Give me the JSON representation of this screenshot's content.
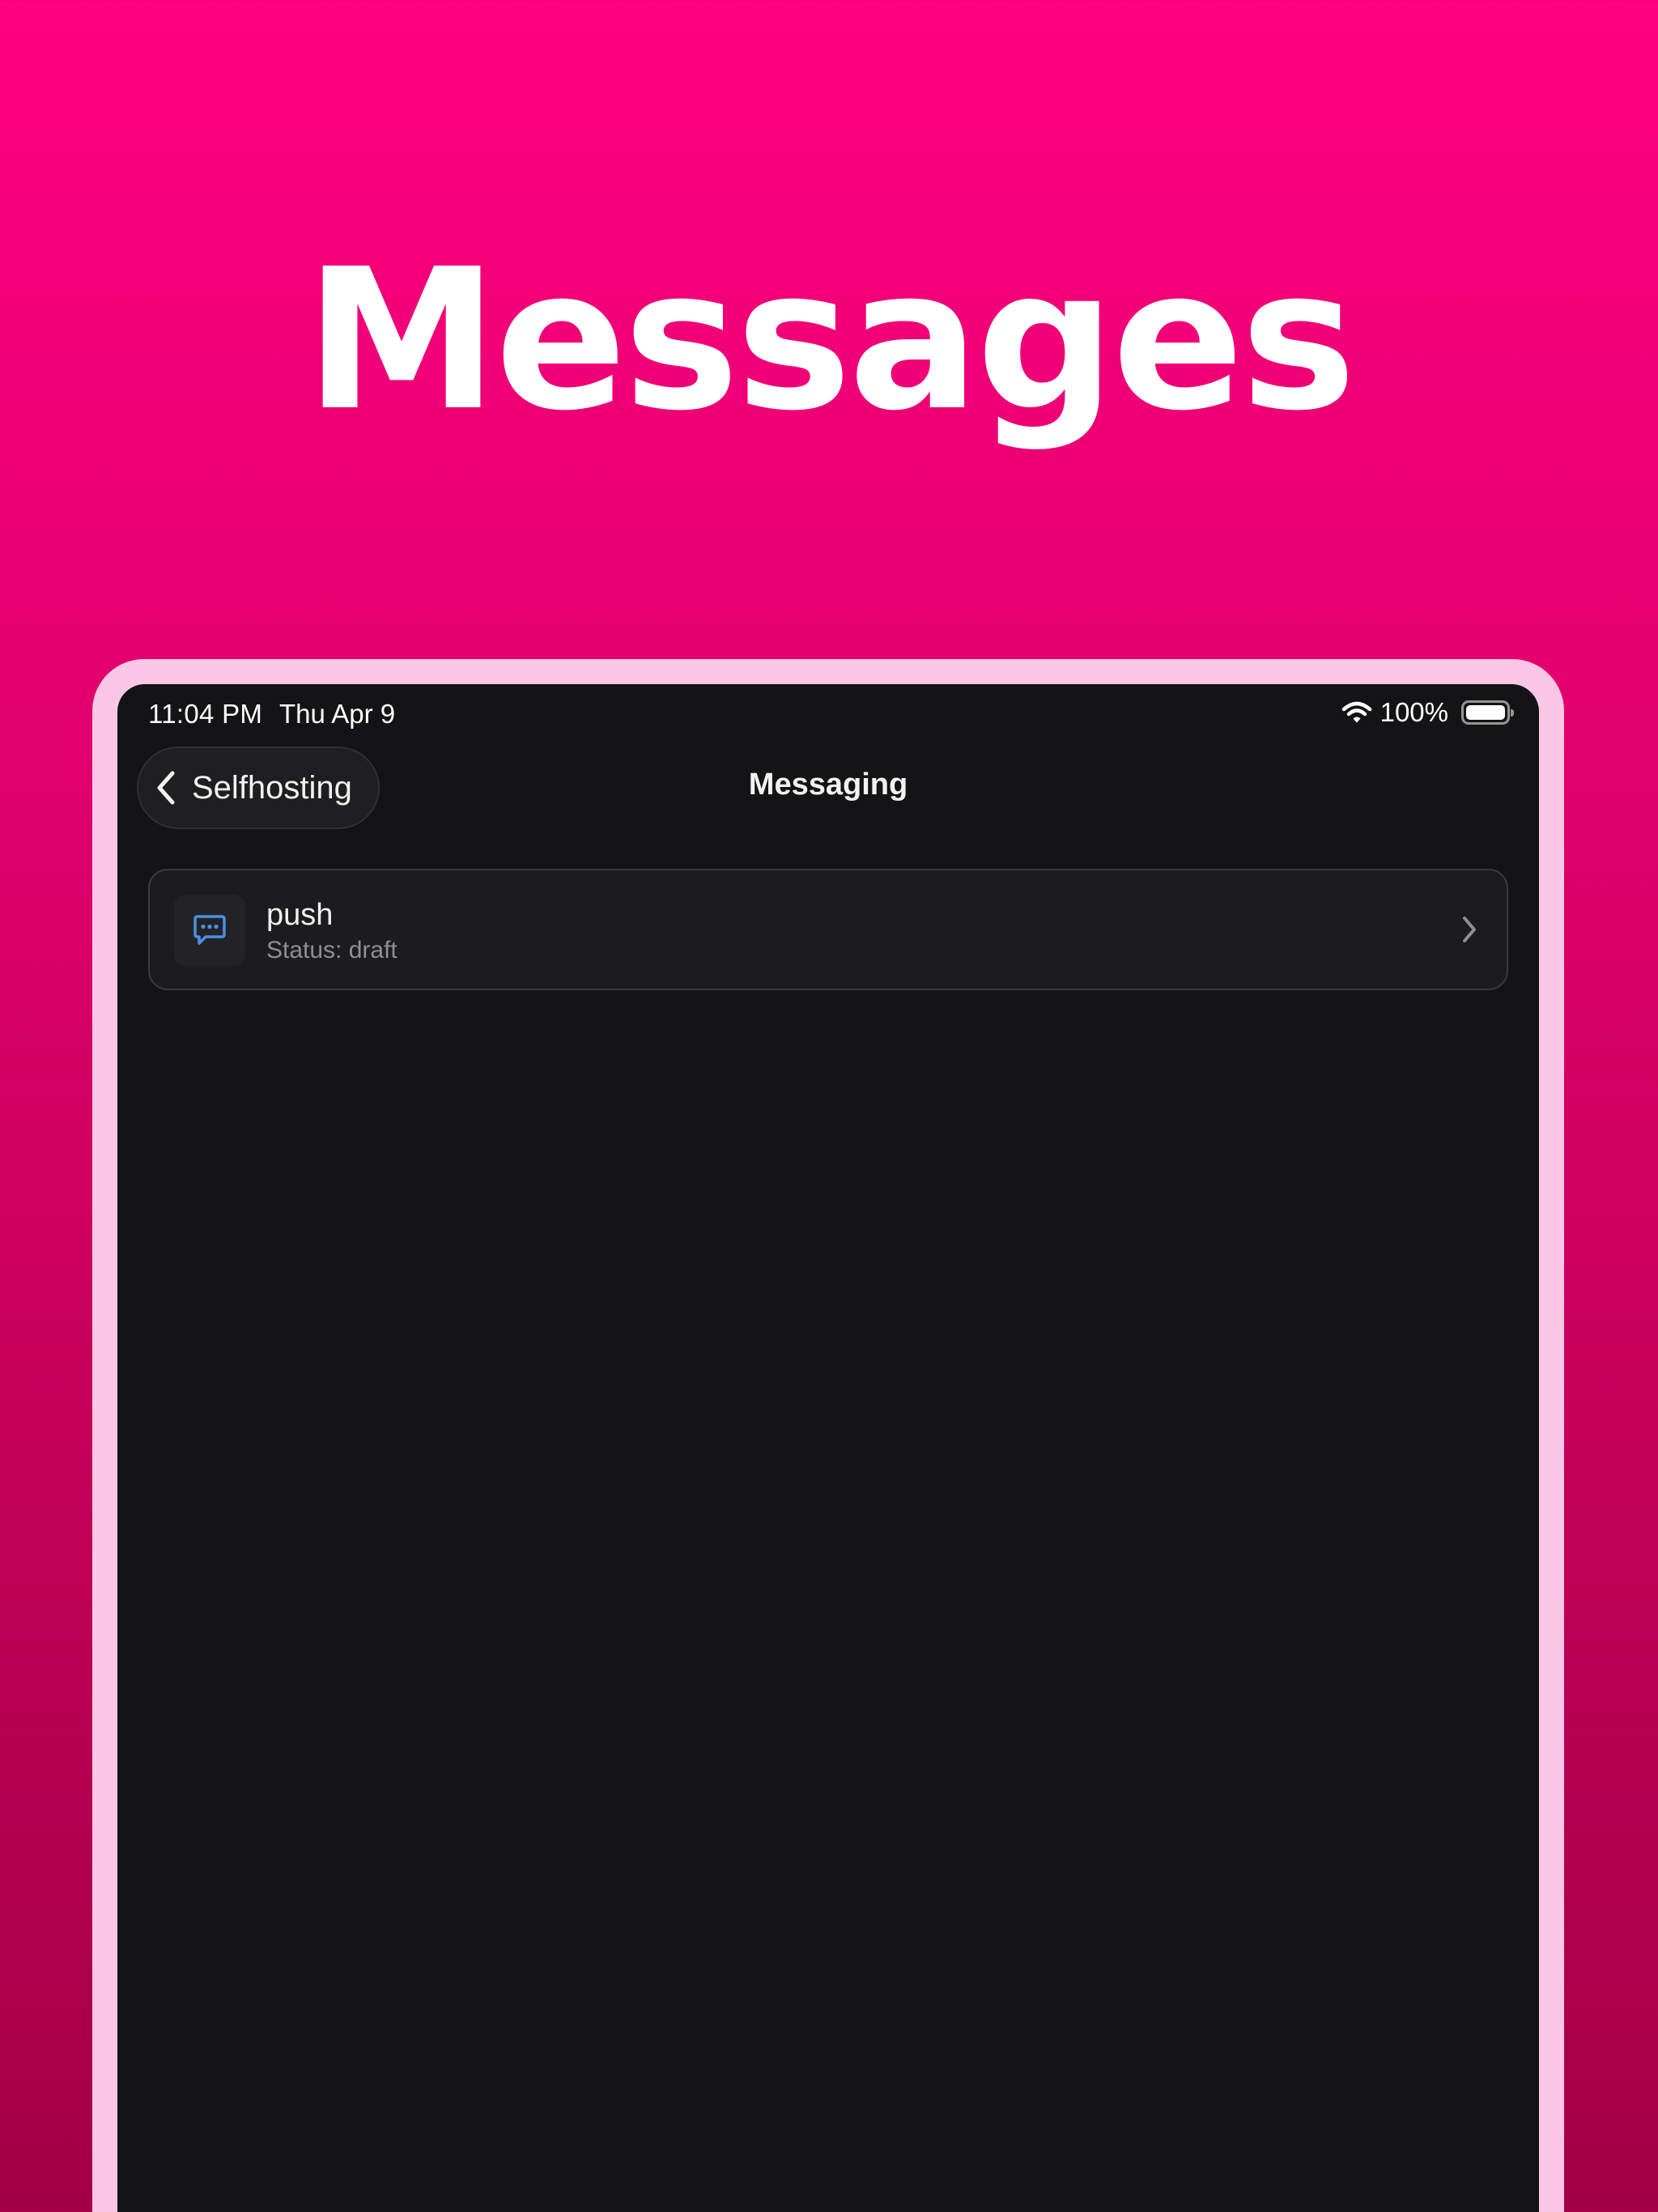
{
  "headline": "Messages",
  "status_bar": {
    "time": "11:04 PM",
    "date": "Thu Apr 9",
    "battery": "100%",
    "icons": [
      "wifi-icon",
      "battery-icon"
    ]
  },
  "nav": {
    "back_label": "Selfhosting",
    "back_icon": "chevron-left-icon",
    "title": "Messaging"
  },
  "items": [
    {
      "title": "push",
      "subtitle": "Status: draft",
      "icon": "chat-bubble-icon",
      "trailing_icon": "chevron-right-icon"
    }
  ],
  "colors": {
    "background_top": "#ff0080",
    "background_bottom": "#a20045",
    "device_frame": "#fcc7e6",
    "screen": "#141416",
    "card": "#1c1c1f",
    "icon_accent": "#4a90e2",
    "subtitle_text": "#8e8e93"
  }
}
